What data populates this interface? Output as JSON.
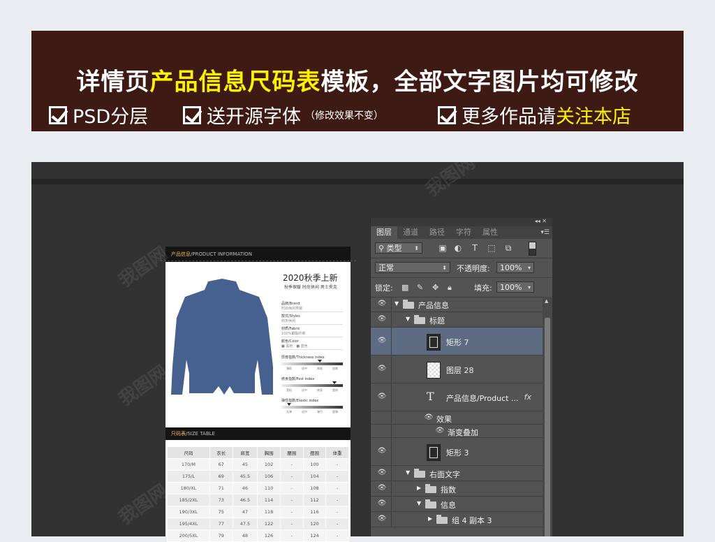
{
  "banner": {
    "title_part1": "详情页",
    "title_highlight": "产品信息尺码表",
    "title_part2": "模板，全部文字图片均可修改",
    "feature1": "PSD分层",
    "feature2": "送开源字体",
    "feature2_note": "（修改效果不变）",
    "feature3_part1": "更多作品请",
    "feature3_highlight": "关注本店"
  },
  "document": {
    "header_cn": "产品信息",
    "header_en": "/PRODUCT INFORMATION",
    "product_title": "2020秋季上新",
    "product_subtitle": "秋季保暖 时尚休闲 男士夹克",
    "jacket_color": "#46608f",
    "specs": [
      {
        "label": "品牌/Brand",
        "value": "时尚休闲男装"
      },
      {
        "label": "款式/Styles",
        "value": "商务休闲"
      },
      {
        "label": "材质/Fabric",
        "value": "100%聚酯纤维"
      },
      {
        "label": "颜色/Color",
        "value": "■ 黑色　■ 蓝色"
      }
    ],
    "indexes": [
      {
        "label": "厚度指数/Thickness index",
        "ticks": [
          "薄款",
          "适中",
          "厚款",
          "加厚"
        ],
        "level": 0.62
      },
      {
        "label": "修身指数/Fest index",
        "ticks": [
          "宽松",
          "适中",
          "修身",
          "超修"
        ],
        "level": 0.86
      },
      {
        "label": "弹性指数/Elastic index",
        "ticks": [
          "无弹",
          "适中",
          "弹力",
          "超弹"
        ],
        "level": 0.12
      }
    ],
    "size_header_cn": "尺码表",
    "size_header_en": "/SIZE TABLE",
    "size_columns": [
      "尺码",
      "衣长",
      "肩宽",
      "胸围",
      "腰围",
      "摆围",
      "体重"
    ],
    "size_rows": [
      [
        "170/M",
        "67",
        "45",
        "102",
        "-",
        "100",
        "-"
      ],
      [
        "175/L",
        "69",
        "45.5",
        "106",
        "-",
        "104",
        "-"
      ],
      [
        "180/XL",
        "71",
        "46",
        "110",
        "-",
        "108",
        "-"
      ],
      [
        "185/2XL",
        "73",
        "46.5",
        "114",
        "-",
        "112",
        "-"
      ],
      [
        "190/3XL",
        "75",
        "47",
        "118",
        "-",
        "116",
        "-"
      ],
      [
        "195/4XL",
        "77",
        "47.5",
        "122",
        "-",
        "120",
        "-"
      ],
      [
        "200/5XL",
        "79",
        "48",
        "126",
        "-",
        "124",
        "-"
      ]
    ]
  },
  "layers_panel": {
    "window_controls": "◂◂  ✕",
    "tabs": [
      "图层",
      "通道",
      "路径",
      "字符",
      "属性"
    ],
    "tab_menu": "▾☰",
    "filter_kind": "类型",
    "blend_mode": "正常",
    "opacity_label": "不透明度:",
    "opacity_value": "100%",
    "lock_label": "锁定:",
    "fill_label": "填充:",
    "fill_value": "100%",
    "layers": [
      {
        "name": "产品信息",
        "type": "group",
        "open": true
      },
      {
        "name": "标题",
        "type": "group",
        "open": true
      },
      {
        "name": "矩形 7",
        "type": "shape",
        "selected": true
      },
      {
        "name": "图层 28",
        "type": "pixel"
      },
      {
        "name": "产品信息/Product ...",
        "type": "text",
        "fx": "fx"
      },
      {
        "name": "效果",
        "type": "effect"
      },
      {
        "name": "渐变叠加",
        "type": "effect"
      },
      {
        "name": "矩形 3",
        "type": "shape"
      },
      {
        "name": "右面文字",
        "type": "group",
        "open": true
      },
      {
        "name": "指数",
        "type": "group",
        "open": false
      },
      {
        "name": "信息",
        "type": "group",
        "open": true
      },
      {
        "name": "组 4 副本 3",
        "type": "group",
        "open": false
      }
    ]
  }
}
